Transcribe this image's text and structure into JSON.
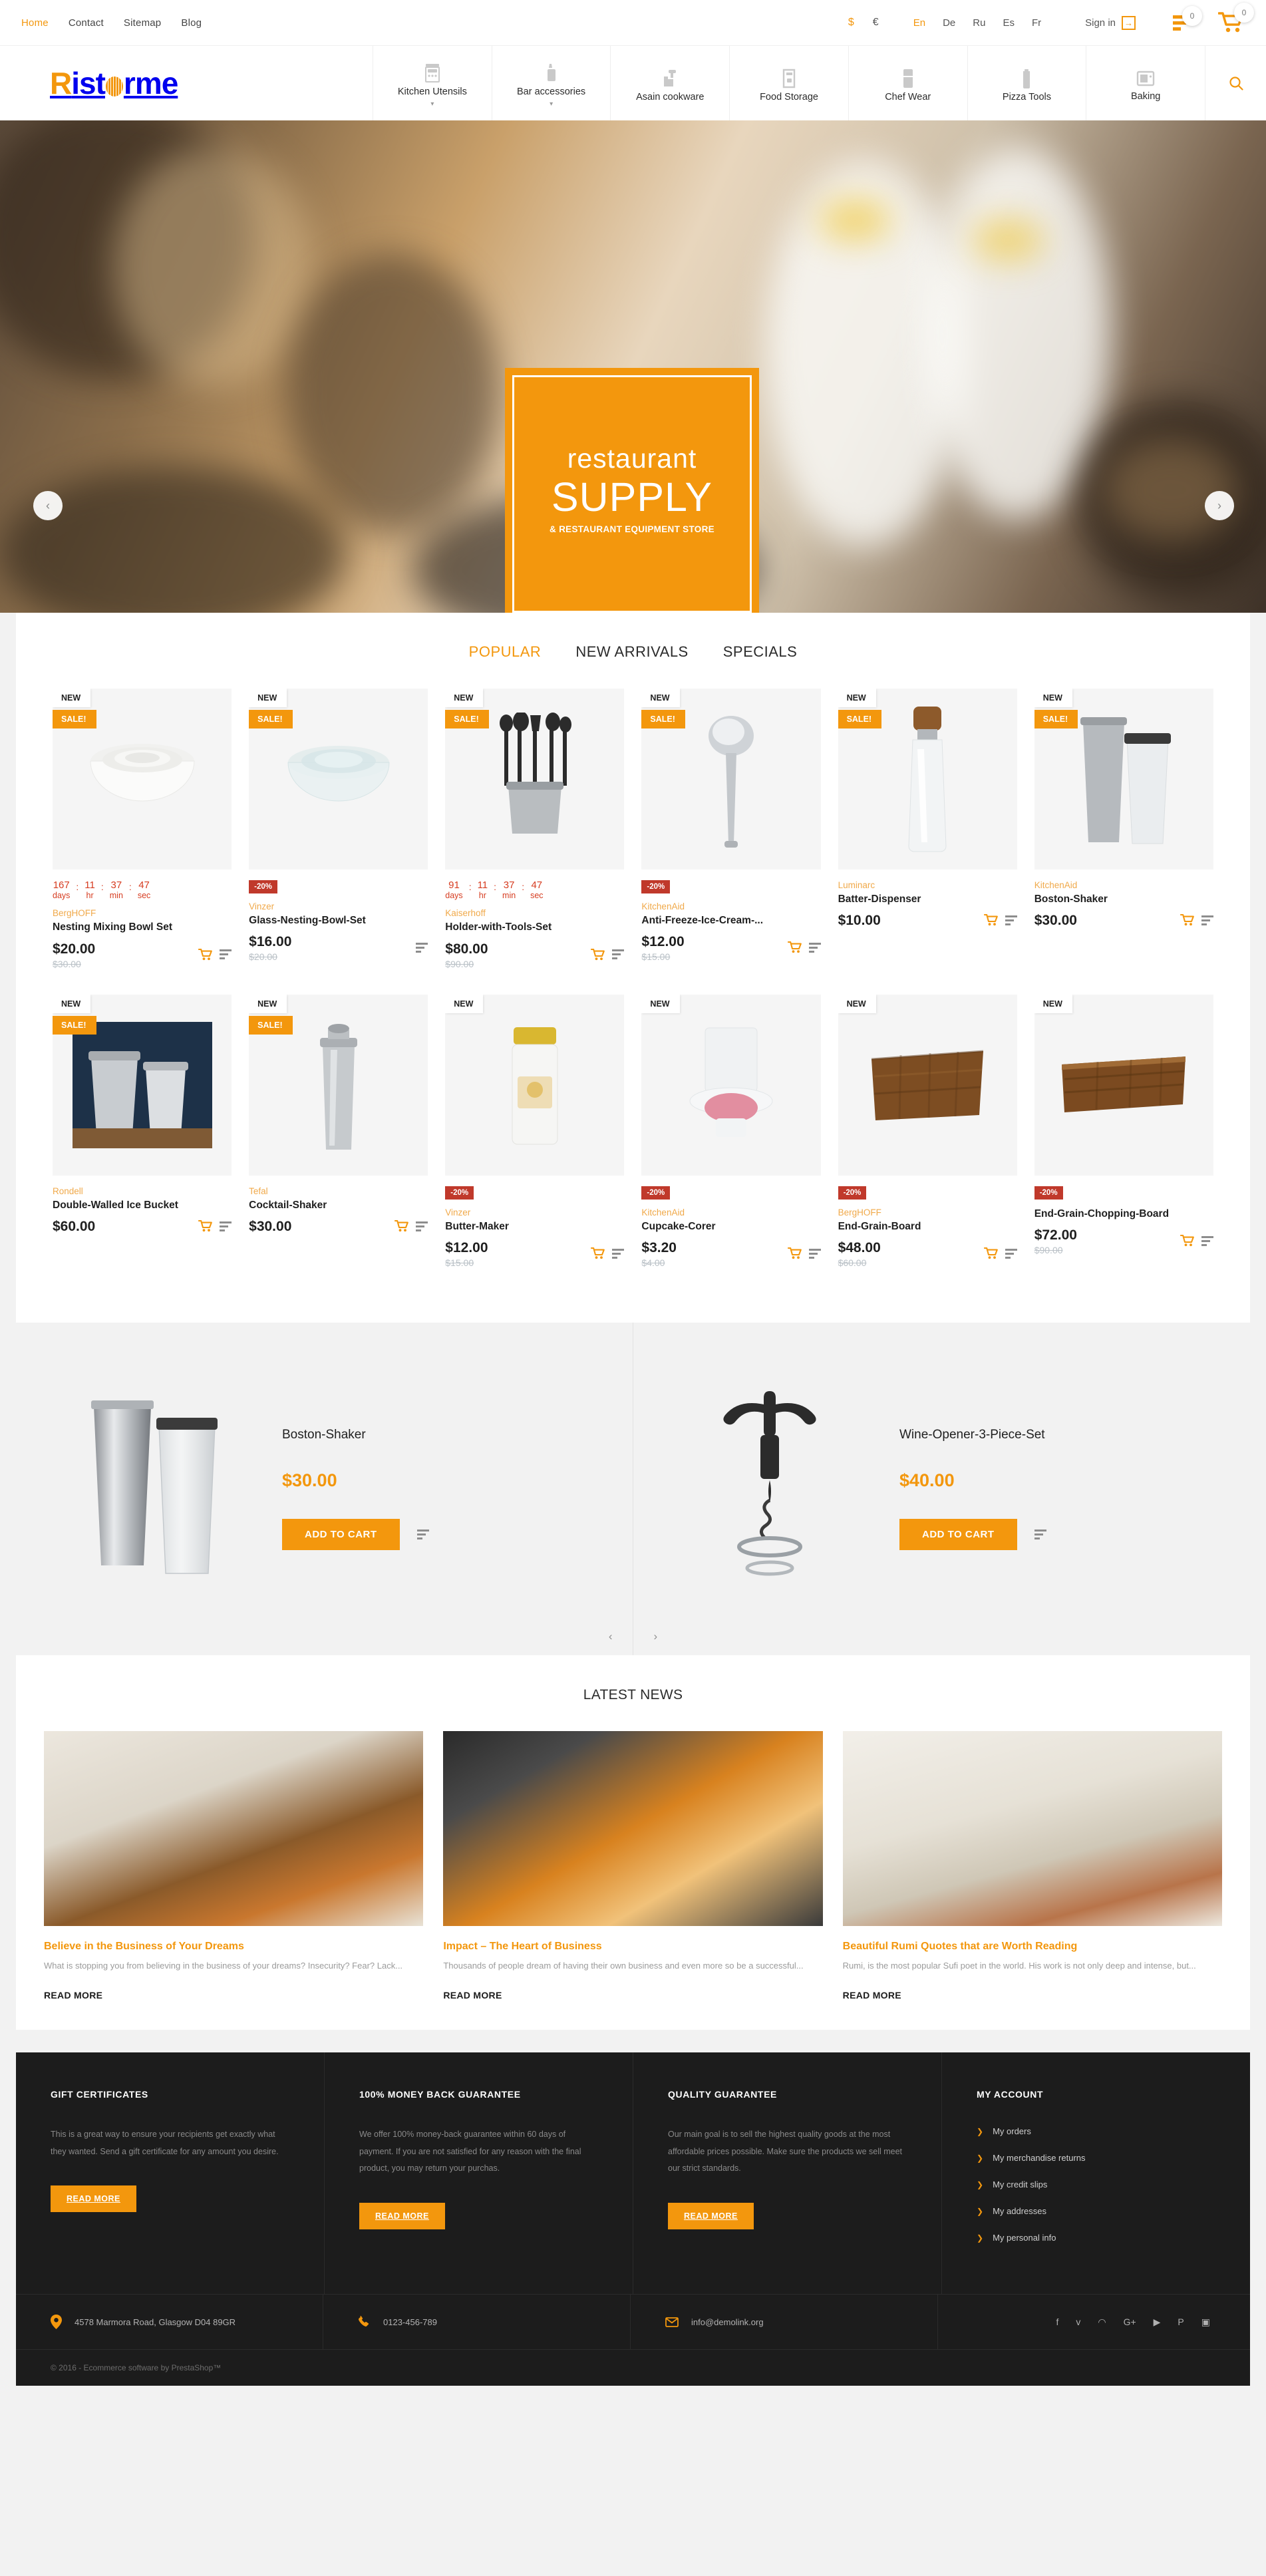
{
  "topbar": {
    "links": [
      {
        "label": "Home",
        "active": true
      },
      {
        "label": "Contact",
        "active": false
      },
      {
        "label": "Sitemap",
        "active": false
      },
      {
        "label": "Blog",
        "active": false
      }
    ],
    "currencies": [
      {
        "label": "$",
        "active": true
      },
      {
        "label": "€",
        "active": false
      }
    ],
    "languages": [
      {
        "label": "En",
        "active": true
      },
      {
        "label": "De",
        "active": false
      },
      {
        "label": "Ru",
        "active": false
      },
      {
        "label": "Es",
        "active": false
      },
      {
        "label": "Fr",
        "active": false
      }
    ],
    "sign_in": "Sign in",
    "compare_count": "0",
    "cart_count": "0"
  },
  "logo": {
    "part1": "R",
    "part2": "ist",
    "part3": "rme"
  },
  "nav": {
    "items": [
      {
        "label": "Kitchen Utensils",
        "icon": "stove-icon",
        "has_dropdown": true
      },
      {
        "label": "Bar accessories",
        "icon": "blender-icon",
        "has_dropdown": true
      },
      {
        "label": "Asain cookware",
        "icon": "mixer-icon",
        "has_dropdown": false
      },
      {
        "label": "Food Storage",
        "icon": "coffee-machine-icon",
        "has_dropdown": false
      },
      {
        "label": "Chef Wear",
        "icon": "fridge-icon",
        "has_dropdown": false
      },
      {
        "label": "Pizza Tools",
        "icon": "kettle-icon",
        "has_dropdown": false
      },
      {
        "label": "Baking",
        "icon": "microwave-icon",
        "has_dropdown": false
      }
    ],
    "search_icon": "search-icon"
  },
  "hero": {
    "line1": "restaurant",
    "line2": "SUPPLY",
    "line3": "& RESTAURANT EQUIPMENT STORE",
    "prev": "‹",
    "next": "›",
    "accent": "#f3970d"
  },
  "tabs": [
    {
      "label": "POPULAR",
      "active": true
    },
    {
      "label": "NEW ARRIVALS",
      "active": false
    },
    {
      "label": "SPECIALS",
      "active": false
    }
  ],
  "products": [
    {
      "brand": "BergHOFF",
      "name": "Nesting Mixing Bowl Set",
      "price": "$20.00",
      "price_old": "$30.00",
      "flag_new": "NEW",
      "flag_sale": "SALE!",
      "discount": null,
      "countdown": {
        "days": "167",
        "hr": "11",
        "min": "37",
        "sec": "47",
        "l_days": "days",
        "l_hr": "hr",
        "l_min": "min",
        "l_sec": "sec"
      },
      "has_cart": true,
      "img": "white-nesting-bowls"
    },
    {
      "brand": "Vinzer",
      "name": "Glass-Nesting-Bowl-Set",
      "price": "$16.00",
      "price_old": "$20.00",
      "flag_new": "NEW",
      "flag_sale": "SALE!",
      "discount": "-20%",
      "countdown": null,
      "has_cart": false,
      "img": "glass-bowls"
    },
    {
      "brand": "Kaiserhoff",
      "name": "Holder-with-Tools-Set",
      "price": "$80.00",
      "price_old": "$90.00",
      "flag_new": "NEW",
      "flag_sale": "SALE!",
      "discount": null,
      "countdown": {
        "days": "91",
        "hr": "11",
        "min": "37",
        "sec": "47",
        "l_days": "days",
        "l_hr": "hr",
        "l_min": "min",
        "l_sec": "sec"
      },
      "has_cart": true,
      "img": "utensil-holder"
    },
    {
      "brand": "KitchenAid",
      "name": "Anti-Freeze-Ice-Cream-...",
      "price": "$12.00",
      "price_old": "$15.00",
      "flag_new": "NEW",
      "flag_sale": "SALE!",
      "discount": "-20%",
      "countdown": null,
      "has_cart": true,
      "img": "ice-cream-scoop"
    },
    {
      "brand": "Luminarc",
      "name": "Batter-Dispenser",
      "price": "$10.00",
      "price_old": null,
      "flag_new": "NEW",
      "flag_sale": "SALE!",
      "discount": null,
      "countdown": null,
      "has_cart": true,
      "img": "batter-dispenser"
    },
    {
      "brand": "KitchenAid",
      "name": "Boston-Shaker",
      "price": "$30.00",
      "price_old": null,
      "flag_new": "NEW",
      "flag_sale": "SALE!",
      "discount": null,
      "countdown": null,
      "has_cart": true,
      "img": "boston-shaker"
    },
    {
      "brand": "Rondell",
      "name": "Double-Walled Ice Bucket",
      "price": "$60.00",
      "price_old": null,
      "flag_new": "NEW",
      "flag_sale": "SALE!",
      "discount": null,
      "countdown": null,
      "has_cart": true,
      "img": "ice-bucket"
    },
    {
      "brand": "Tefal",
      "name": "Cocktail-Shaker",
      "price": "$30.00",
      "price_old": null,
      "flag_new": "NEW",
      "flag_sale": "SALE!",
      "discount": null,
      "countdown": null,
      "has_cart": true,
      "img": "cocktail-shaker"
    },
    {
      "brand": "Vinzer",
      "name": "Butter-Maker",
      "price": "$12.00",
      "price_old": "$15.00",
      "flag_new": "NEW",
      "flag_sale": null,
      "discount": "-20%",
      "countdown": null,
      "has_cart": true,
      "img": "butter-maker"
    },
    {
      "brand": "KitchenAid",
      "name": "Cupcake-Corer",
      "price": "$3.20",
      "price_old": "$4.00",
      "flag_new": "NEW",
      "flag_sale": null,
      "discount": "-20%",
      "countdown": null,
      "has_cart": true,
      "img": "cupcake-corer"
    },
    {
      "brand": "BergHOFF",
      "name": "End-Grain-Board",
      "price": "$48.00",
      "price_old": "$60.00",
      "flag_new": "NEW",
      "flag_sale": null,
      "discount": "-20%",
      "countdown": null,
      "has_cart": true,
      "img": "end-grain-board"
    },
    {
      "brand": null,
      "name": "End-Grain-Chopping-Board",
      "price": "$72.00",
      "price_old": "$90.00",
      "flag_new": "NEW",
      "flag_sale": null,
      "discount": "-20%",
      "countdown": null,
      "has_cart": true,
      "img": "chopping-board"
    }
  ],
  "featured": {
    "items": [
      {
        "name": "Boston-Shaker",
        "price": "$30.00",
        "button": "ADD TO CART",
        "img": "boston-shaker-large"
      },
      {
        "name": "Wine-Opener-3-Piece-Set",
        "price": "$40.00",
        "button": "ADD TO CART",
        "img": "wine-opener-large"
      }
    ],
    "prev": "‹",
    "next": "›"
  },
  "news": {
    "title": "LATEST NEWS",
    "items": [
      {
        "heading": "Believe in the Business of Your Dreams",
        "excerpt": "What is stopping you from believing in the business of your dreams? Insecurity? Fear? Lack...",
        "more": "READ MORE",
        "img": "galette-pie"
      },
      {
        "heading": "Impact – The Heart of Business",
        "excerpt": "Thousands of people dream of having their own business and even more so be a successful...",
        "more": "READ MORE",
        "img": "pastry-dessert"
      },
      {
        "heading": "Beautiful Rumi Quotes that are Worth Reading",
        "excerpt": "Rumi, is the most popular Sufi poet in the world. His work is not only deep and intense, but...",
        "more": "READ MORE",
        "img": "toaster-breakfast"
      }
    ]
  },
  "footer": {
    "columns": [
      {
        "heading": "GIFT CERTIFICATES",
        "text": "This is a great way to ensure your recipients get exactly what they wanted. Send a gift certificate for any amount you desire.",
        "button": "READ MORE"
      },
      {
        "heading": "100% MONEY BACK GUARANTEE",
        "text": "We offer 100% money-back guarantee within 60 days of payment. If you are not satisfied for any reason with the final product, you may return your purchas.",
        "button": "READ MORE"
      },
      {
        "heading": "QUALITY GUARANTEE",
        "text": "Our main goal is to sell the highest quality goods at the most affordable prices possible. Make sure the products we sell meet our strict standards.",
        "button": "READ MORE"
      }
    ],
    "account": {
      "heading": "MY ACCOUNT",
      "links": [
        "My orders",
        "My merchandise returns",
        "My credit slips",
        "My addresses",
        "My personal info"
      ]
    },
    "contact": {
      "address": "4578 Marmora Road, Glasgow D04 89GR",
      "phone": "0123-456-789",
      "email": "info@demolink.org"
    },
    "social": [
      "facebook-icon",
      "twitter-icon",
      "rss-icon",
      "google-plus-icon",
      "youtube-icon",
      "pinterest-icon",
      "instagram-icon"
    ],
    "copyright": "© 2016 - Ecommerce software by PrestaShop™"
  }
}
